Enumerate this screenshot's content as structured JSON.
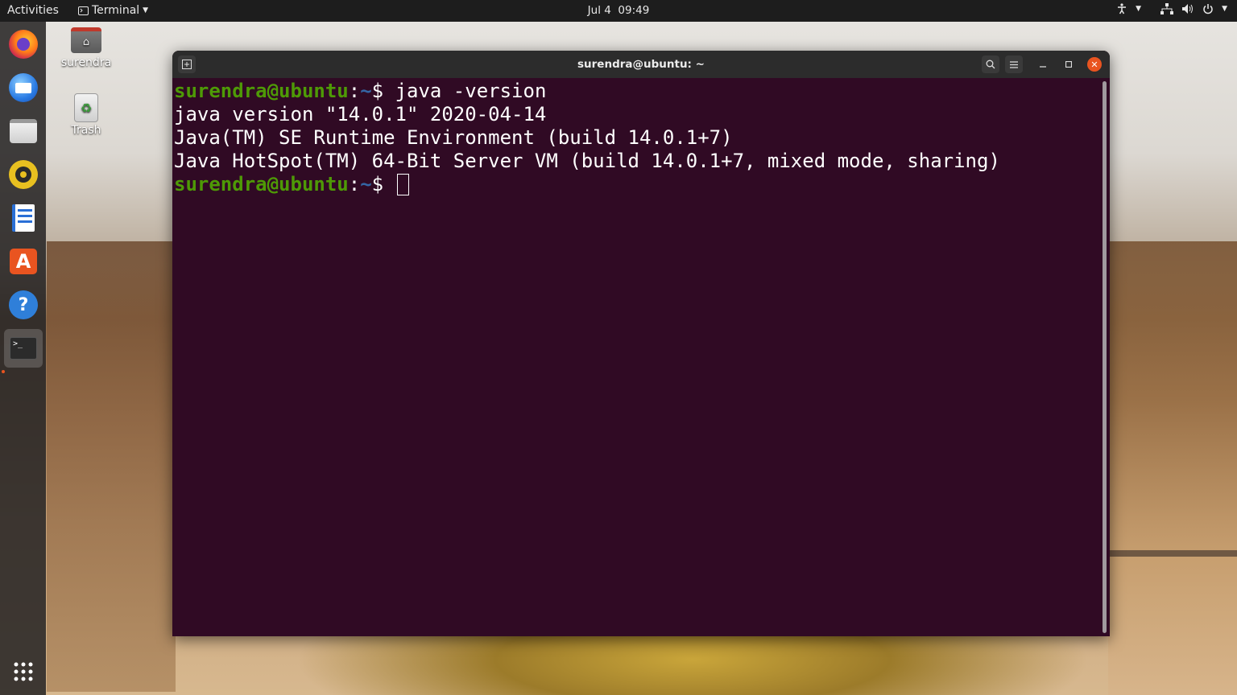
{
  "topbar": {
    "activities": "Activities",
    "app_name": "Terminal",
    "date": "Jul 4",
    "time": "09:49"
  },
  "dock": {
    "items": [
      {
        "name": "firefox",
        "icon": "firefox-icon"
      },
      {
        "name": "thunderbird",
        "icon": "mail-icon"
      },
      {
        "name": "files",
        "icon": "folder-icon"
      },
      {
        "name": "rhythmbox",
        "icon": "music-icon"
      },
      {
        "name": "libreoffice-writer",
        "icon": "document-icon"
      },
      {
        "name": "ubuntu-software",
        "icon": "software-icon"
      },
      {
        "name": "help",
        "icon": "help-icon",
        "glyph": "?"
      },
      {
        "name": "terminal",
        "icon": "terminal-icon",
        "active": true
      }
    ]
  },
  "desktop": {
    "home_label": "surendra",
    "trash_label": "Trash"
  },
  "terminal": {
    "title": "surendra@ubuntu: ~",
    "prompt_user": "surendra@ubuntu",
    "prompt_sep": ":",
    "prompt_path": "~",
    "prompt_sign": "$ ",
    "command1": "java -version",
    "output": [
      "java version \"14.0.1\" 2020-04-14",
      "Java(TM) SE Runtime Environment (build 14.0.1+7)",
      "Java HotSpot(TM) 64-Bit Server VM (build 14.0.1+7, mixed mode, sharing)"
    ]
  },
  "colors": {
    "terminal_bg": "#300a24",
    "prompt_user": "#4e9a06",
    "prompt_path": "#3465a4",
    "accent": "#e95420"
  }
}
